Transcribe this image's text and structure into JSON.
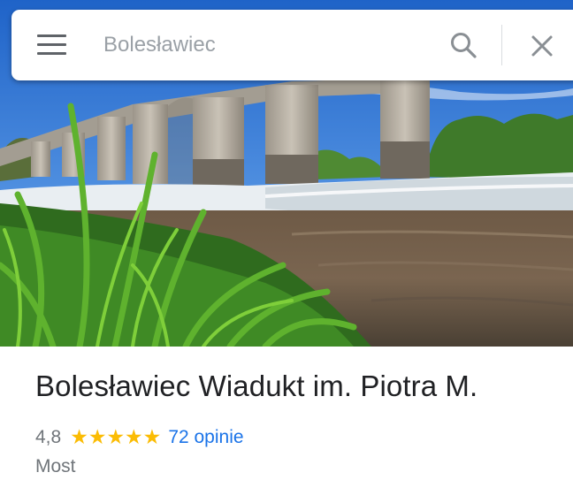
{
  "search": {
    "value": "",
    "placeholder": "Bolesławiec"
  },
  "icons": {
    "menu": "hamburger-menu-icon",
    "search": "search-icon",
    "close": "close-icon"
  },
  "place": {
    "photo": "viaduct-over-river-photo",
    "title": "Bolesławiec Wiadukt im. Piotra M.",
    "rating": "4,8",
    "stars": "★★★★★",
    "stars_value": 5,
    "reviews_label": "72 opinie",
    "category": "Most"
  },
  "colors": {
    "star": "#fbbc04",
    "link": "#1a73e8",
    "secondary_text": "#70757a",
    "title_text": "#202124"
  }
}
